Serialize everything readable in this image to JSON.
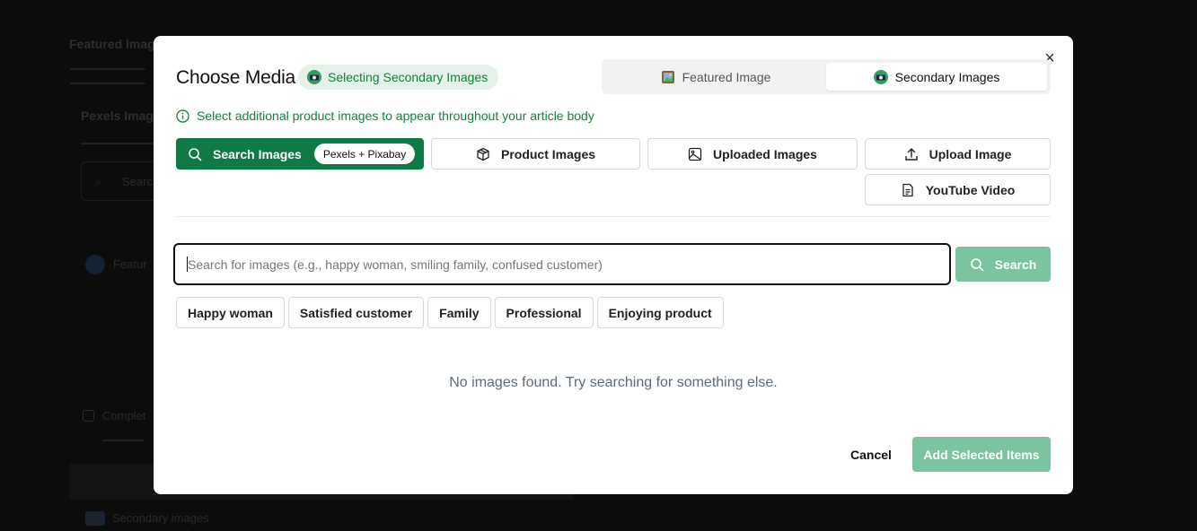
{
  "background": {
    "section_title": "Featured Imag",
    "pexels_label": "Pexels Image",
    "search_fragment": "Searc",
    "featured_fragment": "Featur",
    "complete_fragment": "Complet",
    "secondary_images_label": "Secondary images"
  },
  "modal": {
    "title": "Choose Media",
    "mode_badge": "Selecting Secondary Images",
    "tabs": [
      {
        "label": "Featured Image",
        "active": false
      },
      {
        "label": "Secondary Images",
        "active": true
      }
    ],
    "info_text": "Select additional product images to appear throughout your article body",
    "sources": {
      "search_images": "Search Images",
      "search_provider_pill": "Pexels + Pixabay",
      "product_images": "Product Images",
      "uploaded_images": "Uploaded Images",
      "upload_image": "Upload Image",
      "youtube_video": "YouTube Video"
    },
    "search": {
      "placeholder": "Search for images (e.g., happy woman, smiling family, confused customer)",
      "value": "",
      "button_label": "Search"
    },
    "suggestions": [
      "Happy woman",
      "Satisfied customer",
      "Family",
      "Professional",
      "Enjoying product"
    ],
    "empty_state": "No images found. Try searching for something else.",
    "footer": {
      "cancel_label": "Cancel",
      "add_label": "Add Selected Items"
    },
    "close_glyph": "×"
  },
  "colors": {
    "accent": "#0f7a46",
    "accent_disabled": "#7cc4a0",
    "info_green": "#15803d",
    "overlay": "#0c0c0c"
  },
  "icons": {
    "badge": "camera-icon",
    "tab_featured": "framed-picture-icon",
    "tab_secondary": "camera-icon",
    "info": "info-circle-icon",
    "search": "search-icon",
    "product": "package-icon",
    "uploaded": "image-icon",
    "upload": "upload-icon",
    "youtube": "file-text-icon",
    "close": "close-icon"
  }
}
